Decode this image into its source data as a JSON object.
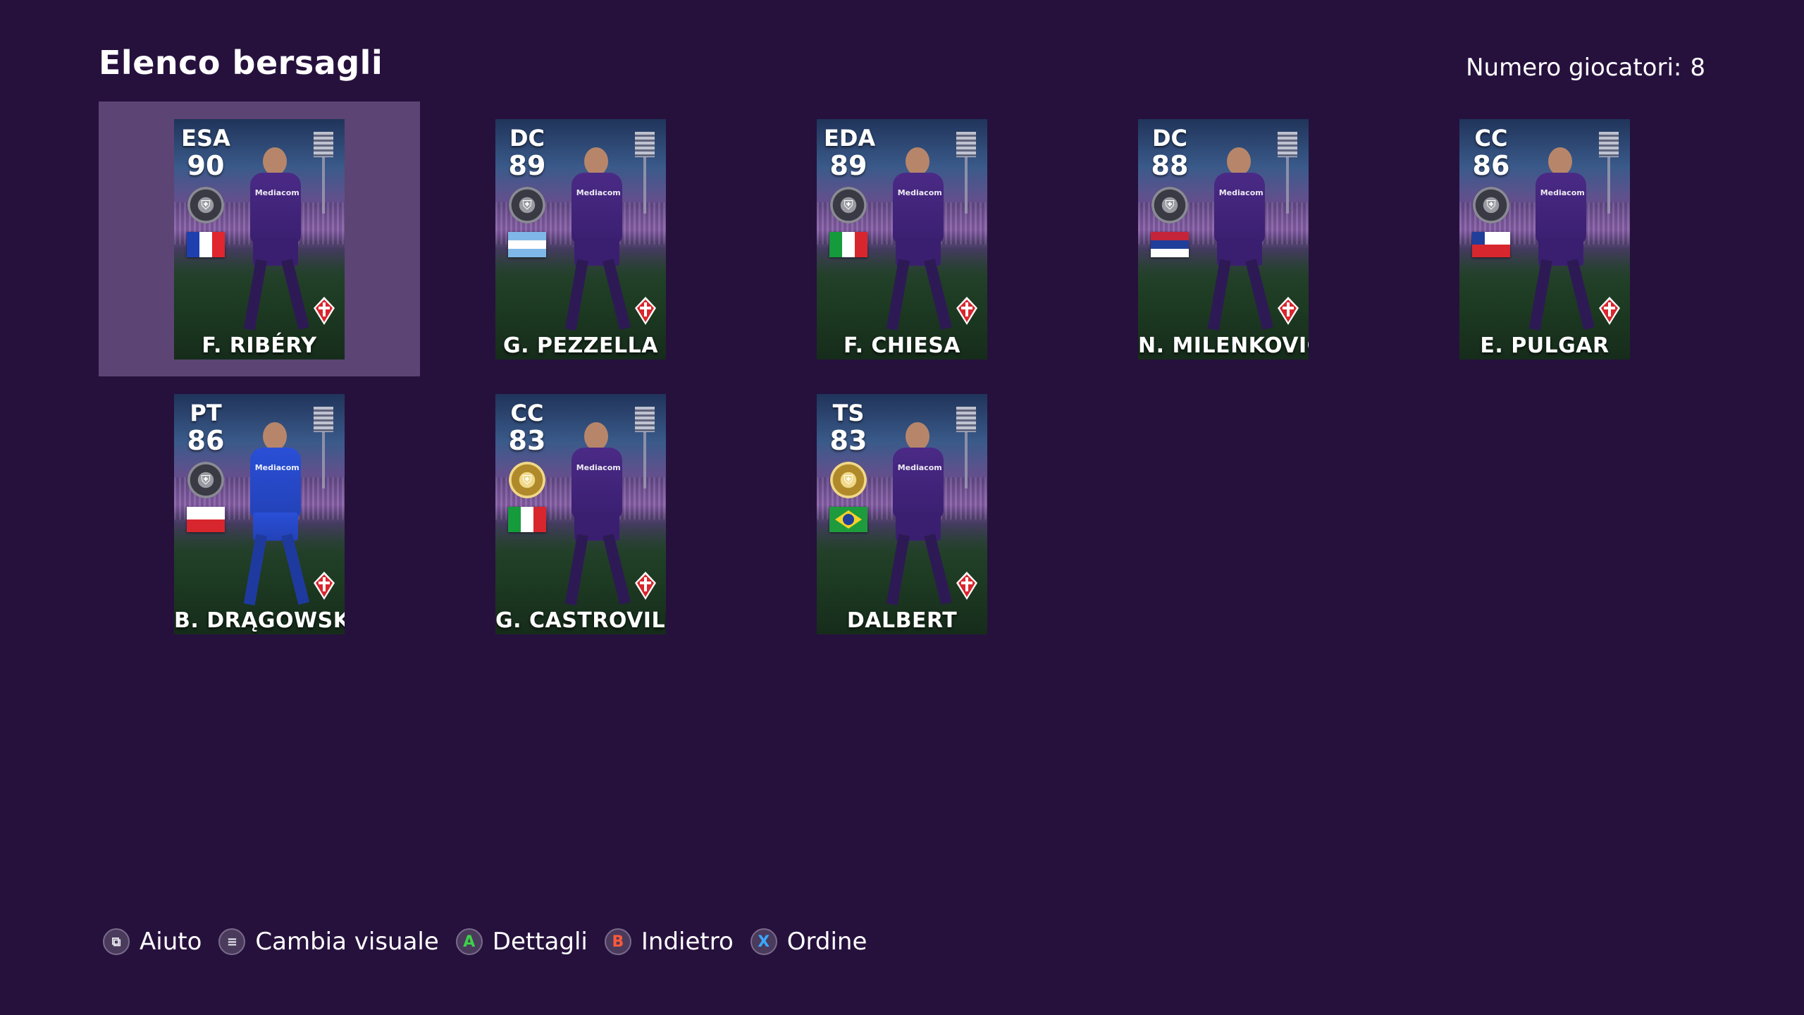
{
  "header": {
    "title": "Elenco bersagli",
    "count_label": "Numero giocatori:",
    "count_value": "8"
  },
  "players": [
    {
      "position": "ESA",
      "rating": "90",
      "name": "F. RIBÉRY",
      "medal": "black",
      "flag": "france-flag",
      "gk": false,
      "selected": true
    },
    {
      "position": "DC",
      "rating": "89",
      "name": "G. PEZZELLA",
      "medal": "black",
      "flag": "argentina-flag",
      "gk": false,
      "selected": false
    },
    {
      "position": "EDA",
      "rating": "89",
      "name": "F. CHIESA",
      "medal": "black",
      "flag": "italy-flag",
      "gk": false,
      "selected": false
    },
    {
      "position": "DC",
      "rating": "88",
      "name": "N. MILENKOVIĆ",
      "medal": "black",
      "flag": "serbia-flag",
      "gk": false,
      "selected": false
    },
    {
      "position": "CC",
      "rating": "86",
      "name": "E. PULGAR",
      "medal": "black",
      "flag": "chile-flag",
      "gk": false,
      "selected": false
    },
    {
      "position": "PT",
      "rating": "86",
      "name": "B. DRĄGOWSKI",
      "medal": "black",
      "flag": "poland-flag",
      "gk": true,
      "selected": false
    },
    {
      "position": "CC",
      "rating": "83",
      "name": "G. CASTROVILLI",
      "medal": "gold",
      "flag": "italy-flag",
      "gk": false,
      "selected": false
    },
    {
      "position": "TS",
      "rating": "83",
      "name": "DALBERT",
      "medal": "gold",
      "flag": "brazil-flag",
      "gk": false,
      "selected": false
    }
  ],
  "card_sponsor": "Mediacom",
  "footer": {
    "help_label": "Aiuto",
    "change_view_label": "Cambia visuale",
    "details_label": "Dettagli",
    "back_label": "Indietro",
    "order_label": "Ordine",
    "a_glyph": "A",
    "b_glyph": "B",
    "x_glyph": "X"
  },
  "colors": {
    "background": "#26113d",
    "selected_slot": "#5c4474",
    "button_a": "#3fd04a",
    "button_b": "#ff5a3a",
    "button_x": "#3aa8ff"
  }
}
